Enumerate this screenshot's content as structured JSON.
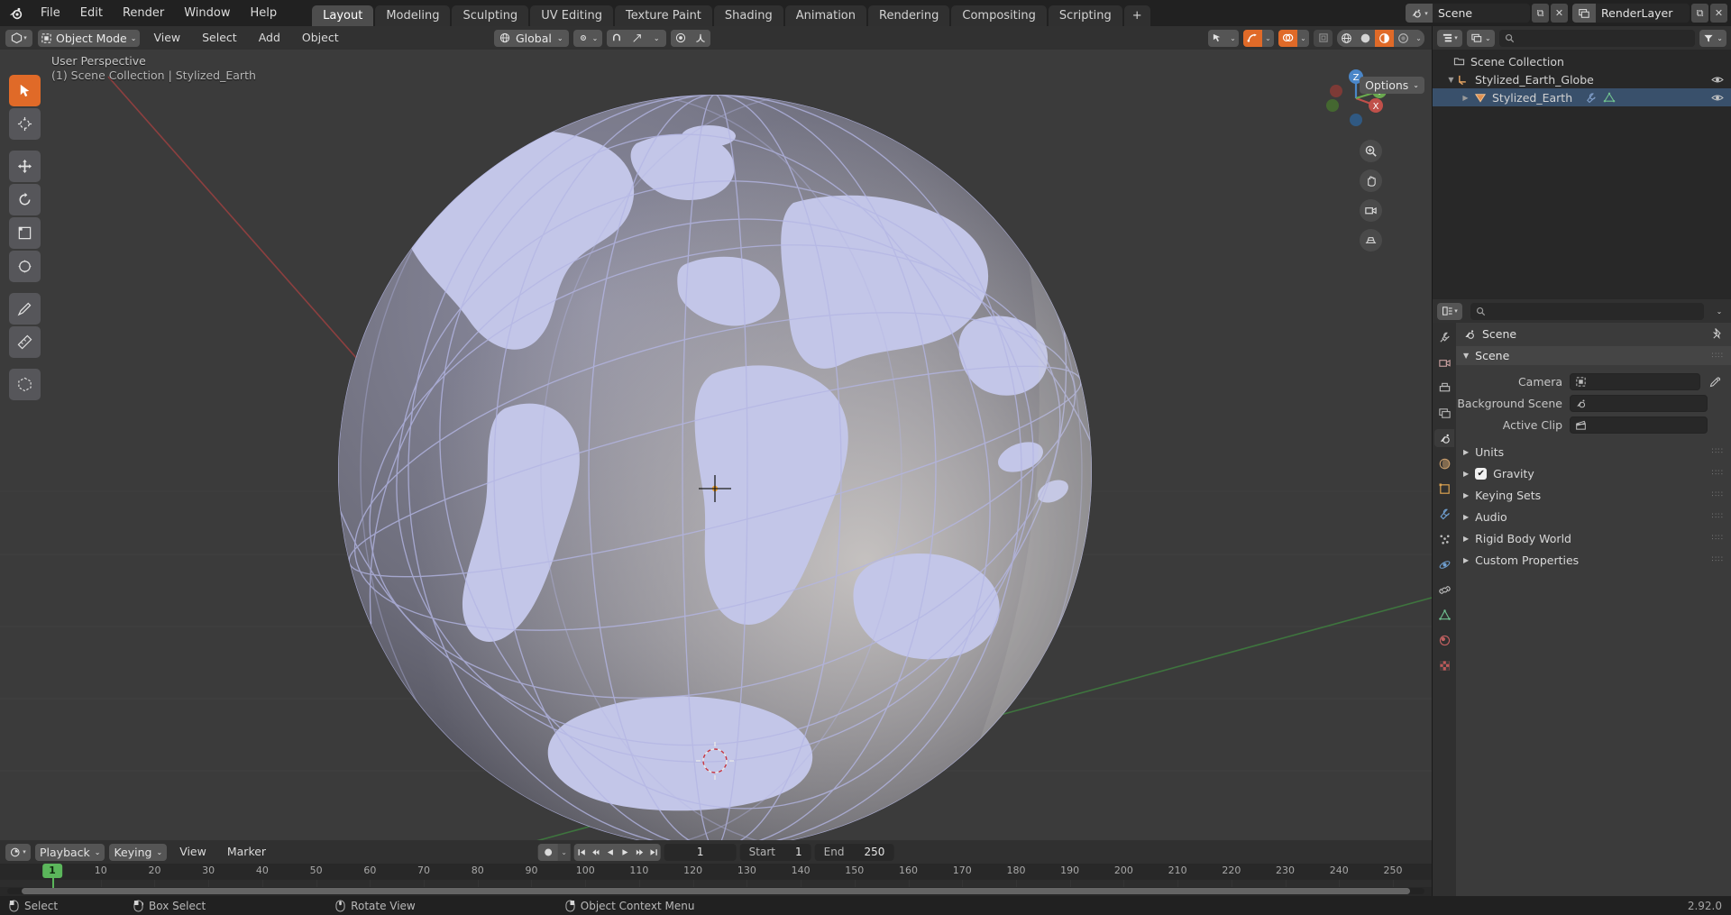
{
  "topbar": {
    "logo_icon": "blender-logo-icon",
    "menus": [
      "File",
      "Edit",
      "Render",
      "Window",
      "Help"
    ],
    "workspace_tabs": [
      {
        "label": "Layout",
        "active": true
      },
      {
        "label": "Modeling",
        "active": false
      },
      {
        "label": "Sculpting",
        "active": false
      },
      {
        "label": "UV Editing",
        "active": false
      },
      {
        "label": "Texture Paint",
        "active": false
      },
      {
        "label": "Shading",
        "active": false
      },
      {
        "label": "Animation",
        "active": false
      },
      {
        "label": "Rendering",
        "active": false
      },
      {
        "label": "Compositing",
        "active": false
      },
      {
        "label": "Scripting",
        "active": false
      },
      {
        "label": "+",
        "active": false
      }
    ],
    "scene": {
      "name": "Scene",
      "icon": "scene-icon",
      "new_icon": "new-scene-icon",
      "unlink_icon": "unlink-icon"
    },
    "view_layer": {
      "name": "RenderLayer",
      "icon": "view-layer-icon",
      "new_icon": "new-layer-icon",
      "unlink_icon": "unlink-icon"
    }
  },
  "viewport_header": {
    "editor_type_icon": "editor-type-3dview-icon",
    "mode": "Object Mode",
    "mode_icon": "object-mode-icon",
    "menus": [
      "View",
      "Select",
      "Add",
      "Object"
    ],
    "transform_orientation": "Global",
    "pivot_icon": "pivot-point-icon",
    "snap_icon": "snap-magnet-icon",
    "proportional_icon": "proportional-edit-icon",
    "options_label": "Options",
    "visibility_icons": [
      "show-gizmo-icon",
      "show-overlays-icon",
      "xray-toggle-icon",
      "camera-view-icon"
    ],
    "shading_icons": [
      "wireframe-shading-icon",
      "solid-shading-icon",
      "material-preview-icon",
      "rendered-shading-icon"
    ]
  },
  "viewport": {
    "overlay_line1": "User Perspective",
    "overlay_line2": "(1) Scene Collection | Stylized_Earth",
    "tools": [
      {
        "name": "tweak-select-tool",
        "active": true
      },
      {
        "name": "cursor-tool",
        "active": false
      },
      {
        "name": "move-tool",
        "active": false
      },
      {
        "name": "rotate-tool",
        "active": false
      },
      {
        "name": "scale-tool",
        "active": false
      },
      {
        "name": "transform-tool",
        "active": false
      },
      {
        "name": "annotate-tool",
        "active": false
      },
      {
        "name": "measure-tool",
        "active": false
      },
      {
        "name": "add-cube-tool",
        "active": false
      }
    ],
    "gizmo_axes": [
      "X",
      "Y",
      "Z"
    ],
    "nav_buttons": [
      "zoom-icon",
      "pan-hand-icon",
      "camera-icon",
      "ortho-persp-icon"
    ],
    "object_name": "Stylized_Earth"
  },
  "outliner": {
    "editor_icon": "outliner-icon",
    "display_mode_icon": "view-layer-display-icon",
    "filter_icon": "filter-icon",
    "search_placeholder": "",
    "search_icon": "search-icon",
    "rows": [
      {
        "label": "Scene Collection",
        "icon": "collection-icon",
        "indent": 0,
        "disclosure": "",
        "eye": false,
        "selected": false
      },
      {
        "label": "Stylized_Earth_Globe",
        "icon": "empty-axes-icon",
        "indent": 1,
        "disclosure": "down",
        "eye": true,
        "selected": false
      },
      {
        "label": "Stylized_Earth",
        "icon": "mesh-object-icon",
        "indent": 2,
        "disclosure": "right",
        "eye": true,
        "selected": true,
        "extra_icons": [
          "modifier-wrench-icon",
          "mesh-data-icon"
        ]
      }
    ]
  },
  "properties": {
    "editor_icon": "properties-icon",
    "search_placeholder": "",
    "breadcrumb": "Scene",
    "breadcrumb_icon": "scene-icon",
    "pin_icon": "pin-icon",
    "tabs": [
      {
        "name": "tool-tab",
        "icon": "tool-icon",
        "active": false
      },
      {
        "name": "render-tab",
        "icon": "render-camera-icon",
        "active": false
      },
      {
        "name": "output-tab",
        "icon": "output-printer-icon",
        "active": false
      },
      {
        "name": "view-layer-tab",
        "icon": "view-layer-images-icon",
        "active": false
      },
      {
        "name": "scene-tab",
        "icon": "scene-cone-icon",
        "active": true
      },
      {
        "name": "world-tab",
        "icon": "world-globe-icon",
        "active": false
      },
      {
        "name": "object-tab",
        "icon": "object-square-icon",
        "active": false
      },
      {
        "name": "modifier-tab",
        "icon": "wrench-icon",
        "active": false
      },
      {
        "name": "particles-tab",
        "icon": "particles-icon",
        "active": false
      },
      {
        "name": "physics-tab",
        "icon": "physics-orbit-icon",
        "active": false
      },
      {
        "name": "constraints-tab",
        "icon": "constraints-icon",
        "active": false
      },
      {
        "name": "data-tab",
        "icon": "mesh-data-triangle-icon",
        "active": false
      },
      {
        "name": "material-tab",
        "icon": "material-sphere-icon",
        "active": false
      },
      {
        "name": "texture-tab",
        "icon": "texture-checker-icon",
        "active": false
      }
    ],
    "panel_title": "Scene",
    "fields": [
      {
        "label": "Camera",
        "value": "",
        "icon": "camera-field-icon",
        "eyedropper": true
      },
      {
        "label": "Background Scene",
        "value": "",
        "icon": "scene-field-icon",
        "eyedropper": false
      },
      {
        "label": "Active Clip",
        "value": "",
        "icon": "clip-field-icon",
        "eyedropper": false
      }
    ],
    "sections": [
      {
        "label": "Units",
        "checkbox": null
      },
      {
        "label": "Gravity",
        "checkbox": true
      },
      {
        "label": "Keying Sets",
        "checkbox": null
      },
      {
        "label": "Audio",
        "checkbox": null
      },
      {
        "label": "Rigid Body World",
        "checkbox": null
      },
      {
        "label": "Custom Properties",
        "checkbox": null
      }
    ]
  },
  "timeline": {
    "editor_icon": "timeline-icon",
    "playback_label": "Playback",
    "keying_label": "Keying",
    "menus": [
      "View",
      "Marker"
    ],
    "record_icon": "auto-keying-icon",
    "transport_icons": [
      "jump-start-icon",
      "prev-keyframe-icon",
      "play-reverse-icon",
      "play-icon",
      "next-keyframe-icon",
      "jump-end-icon"
    ],
    "current_frame": "1",
    "start_label": "Start",
    "start_value": "1",
    "end_label": "End",
    "end_value": "250",
    "ticks": [
      "1",
      "10",
      "20",
      "30",
      "40",
      "50",
      "60",
      "70",
      "80",
      "90",
      "100",
      "110",
      "120",
      "130",
      "140",
      "150",
      "160",
      "170",
      "180",
      "190",
      "200",
      "210",
      "220",
      "230",
      "240",
      "250"
    ],
    "playhead_frame": "1"
  },
  "statusbar": {
    "items": [
      {
        "label": "Select",
        "icon": "mouse-left-icon"
      },
      {
        "label": "Box Select",
        "icon": "mouse-left-drag-icon"
      },
      {
        "label": "Rotate View",
        "icon": "mouse-middle-icon"
      },
      {
        "label": "Object Context Menu",
        "icon": "mouse-right-icon"
      }
    ],
    "version": "2.92.0"
  },
  "colors": {
    "accent": "#e06a28",
    "viewport_bg": "#3b3b3b",
    "panel_bg": "#303030",
    "header_bg": "#313131",
    "dark_bg": "#282828",
    "select_blue": "#39506b",
    "playhead_green": "#5bb65b",
    "globe_land": "#c3c6e8",
    "globe_ocean": "#5a5a63",
    "axis_x_red": "#b54a4a",
    "axis_y_green": "#4a9b4a"
  }
}
